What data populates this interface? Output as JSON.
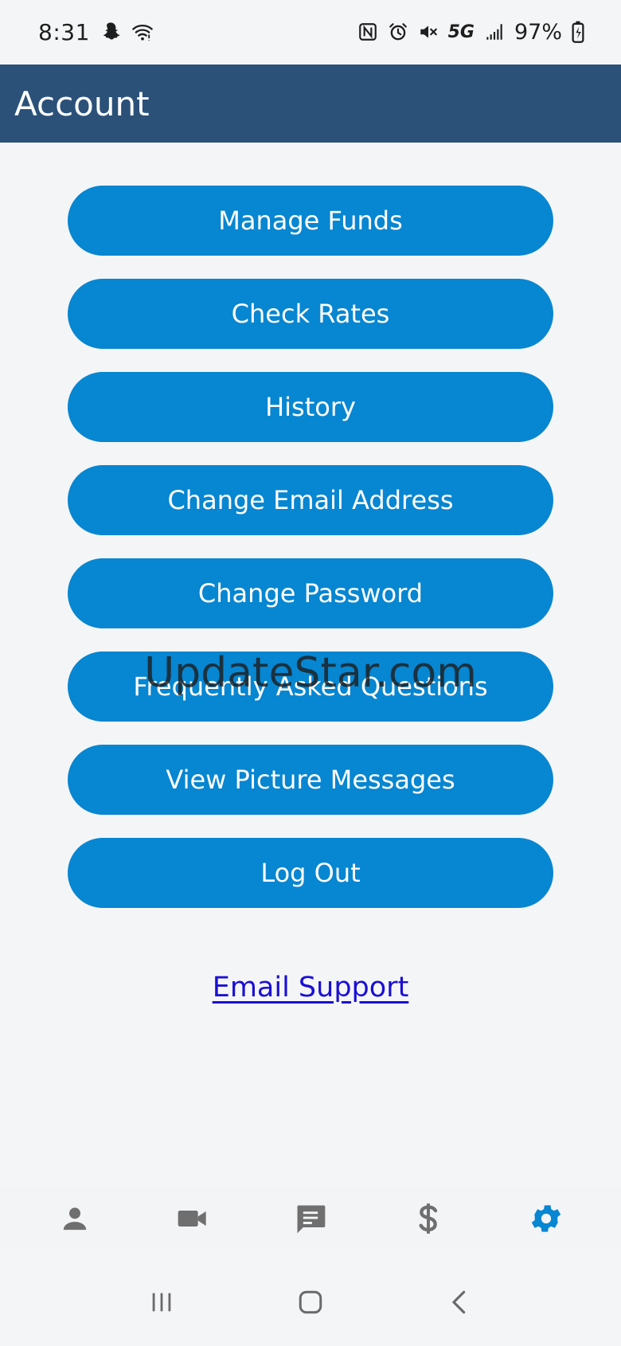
{
  "status_bar": {
    "time": "8:31",
    "network": "5G",
    "battery": "97%"
  },
  "app_bar": {
    "title": "Account"
  },
  "menu": {
    "buttons": [
      {
        "label": "Manage Funds"
      },
      {
        "label": "Check Rates"
      },
      {
        "label": "History"
      },
      {
        "label": "Change Email Address"
      },
      {
        "label": "Change Password"
      },
      {
        "label": "Frequently Asked Questions"
      },
      {
        "label": "View Picture Messages"
      },
      {
        "label": "Log Out"
      }
    ]
  },
  "support": {
    "link_label": "Email Support"
  },
  "watermark": "UpdateStar.com",
  "tab_bar": {
    "items": [
      {
        "icon": "person-icon"
      },
      {
        "icon": "video-camera-icon"
      },
      {
        "icon": "chat-message-icon"
      },
      {
        "icon": "dollar-icon"
      },
      {
        "icon": "gear-icon",
        "active": true
      }
    ]
  },
  "colors": {
    "app_bar": "#2b5179",
    "button": "#0786d1",
    "link": "#1a0fd4",
    "tab_icon": "#6f6f6f",
    "tab_icon_active": "#0786d1"
  }
}
